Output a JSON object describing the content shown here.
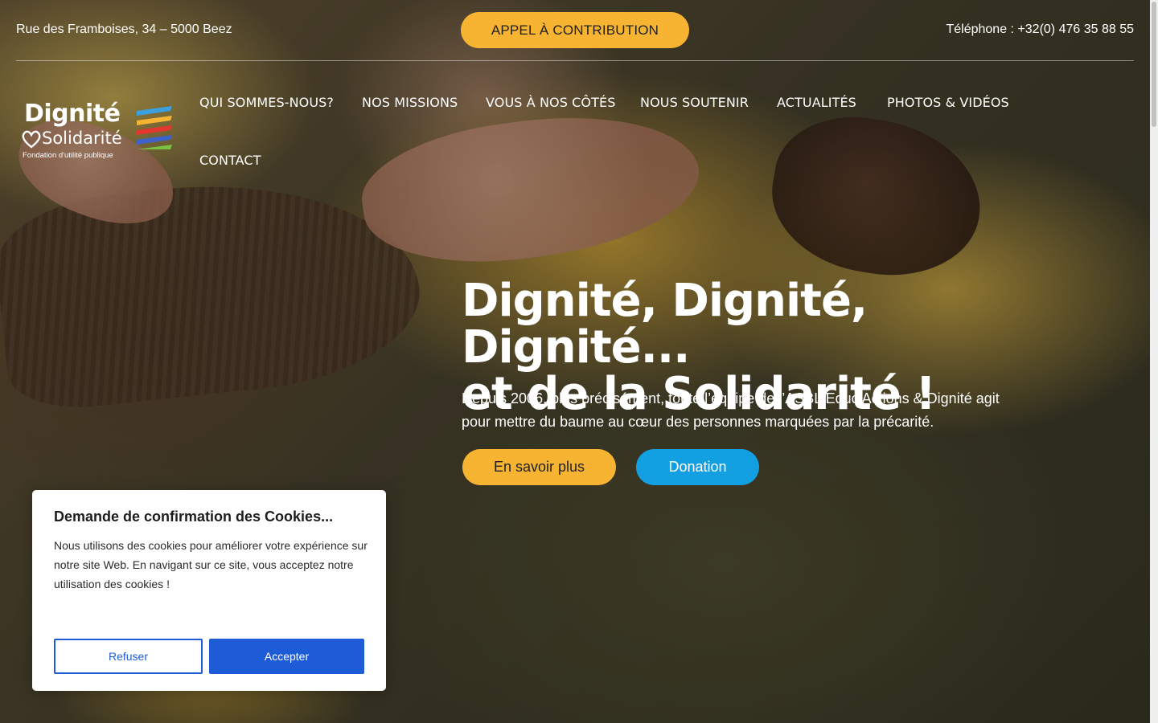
{
  "topbar": {
    "address": "Rue des Framboises, 34 – 5000 Beez",
    "cta_label": "APPEL À CONTRIBUTION",
    "phone": "Téléphone : +32(0) 476 35 88 55"
  },
  "logo": {
    "line1": "Dignité",
    "line2": "Solidarité",
    "tagline": "Fondation d'utilité publique",
    "stripe_colors": [
      "#3aa0e0",
      "#f6b432",
      "#e2362f",
      "#3d63c9",
      "#7cc242"
    ]
  },
  "nav": {
    "items": [
      {
        "label": "QUI SOMMES-NOUS?"
      },
      {
        "label": "NOS MISSIONS"
      },
      {
        "label": "VOUS À NOS CÔTÉS"
      },
      {
        "label": "NOUS SOUTENIR"
      },
      {
        "label": "ACTUALITÉS"
      },
      {
        "label": "PHOTOS & VIDÉOS"
      },
      {
        "label": "CONTACT"
      }
    ]
  },
  "hero": {
    "title_line1": "Dignité, Dignité, Dignité...",
    "title_line2": "et de la Solidarité !",
    "subtitle": "Depuis 2006, plus précisément, toute l’équipe de l’ASBL Educ’Actions & Dignité agit pour mettre du baume au cœur des personnes marquées par la précarité.",
    "btn_more": "En savoir plus",
    "btn_donation": "Donation"
  },
  "cookie": {
    "title": "Demande de confirmation des Cookies...",
    "body": "Nous utilisons des cookies pour améliorer votre expérience sur notre site Web. En navigant sur ce site, vous acceptez notre utilisation des cookies !",
    "refuse_label": "Refuser",
    "accept_label": "Accepter"
  },
  "colors": {
    "accent_yellow": "#f6b432",
    "donation_blue": "#13a0e3",
    "cookie_blue": "#1e5bd6"
  }
}
